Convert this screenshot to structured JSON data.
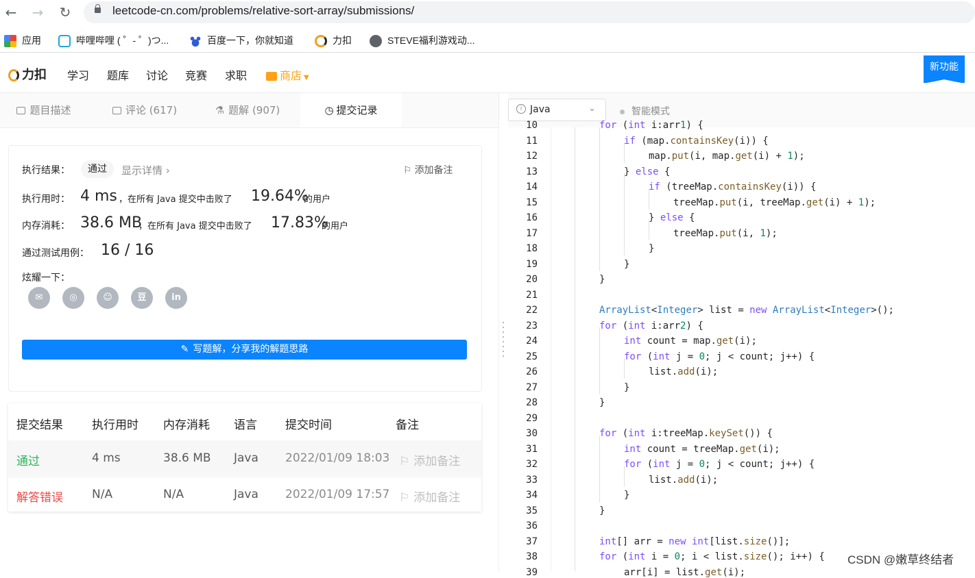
{
  "browser": {
    "url": "leetcode-cn.com/problems/relative-sort-array/submissions/",
    "bookmarks": [
      "应用",
      "哔哩哔哩 ( ゜- ゜)つ...",
      "百度一下，你就知道",
      "力扣",
      "STEVE福利游戏动..."
    ]
  },
  "site": {
    "logo": "力扣",
    "nav": [
      "学习",
      "题库",
      "讨论",
      "竞赛",
      "求职"
    ],
    "shop": "商店",
    "new_feature": "新功能"
  },
  "tabs": [
    {
      "label": "题目描述"
    },
    {
      "label": "评论 (617)"
    },
    {
      "label": "题解 (907)"
    },
    {
      "label": "提交记录"
    }
  ],
  "result": {
    "status_label": "执行结果：",
    "status": "通过",
    "details_link": "显示详情 ›",
    "add_note": "添加备注",
    "runtime_label": "执行用时：",
    "runtime": "4 ms",
    "beat_prefix": "，在所有 Java 提交中击败了",
    "runtime_pct": "19.64%",
    "users": "的用户",
    "memory_label": "内存消耗：",
    "memory": "38.6 MB",
    "memory_pct": "17.83%",
    "tests_label": "通过测试用例：",
    "tests": "16 / 16",
    "share_label": "炫耀一下：",
    "share_icons": [
      "wechat-icon",
      "weibo-icon",
      "qq-icon",
      "douban-icon",
      "linkedin-icon"
    ],
    "share_glyphs": [
      "✉",
      "◎",
      "☺",
      "豆",
      "in"
    ],
    "write_button": "写题解，分享我的解题思路"
  },
  "submissions": {
    "headers": [
      "提交结果",
      "执行用时",
      "内存消耗",
      "语言",
      "提交时间",
      "备注"
    ],
    "rows": [
      {
        "result": "通过",
        "runtime": "4 ms",
        "memory": "38.6 MB",
        "lang": "Java",
        "time": "2022/01/09 18:03",
        "note": "添加备注"
      },
      {
        "result": "解答错误",
        "runtime": "N/A",
        "memory": "N/A",
        "lang": "Java",
        "time": "2022/01/09 17:57",
        "note": "添加备注"
      }
    ]
  },
  "editor": {
    "language": "Java",
    "mode": "智能模式",
    "lines": [
      {
        "n": "10",
        "code": "for (int i:arr1) {"
      },
      {
        "n": "11",
        "code": "if (map.containsKey(i)) {"
      },
      {
        "n": "12",
        "code": "map.put(i, map.get(i) + 1);"
      },
      {
        "n": "13",
        "code": "} else {"
      },
      {
        "n": "14",
        "code": "if (treeMap.containsKey(i)) {"
      },
      {
        "n": "15",
        "code": "treeMap.put(i, treeMap.get(i) + 1);"
      },
      {
        "n": "16",
        "code": "} else {"
      },
      {
        "n": "17",
        "code": "treeMap.put(i, 1);"
      },
      {
        "n": "18",
        "code": "}"
      },
      {
        "n": "19",
        "code": "}"
      },
      {
        "n": "20",
        "code": "}"
      },
      {
        "n": "21",
        "code": ""
      },
      {
        "n": "22",
        "code": "ArrayList<Integer> list = new ArrayList<Integer>();"
      },
      {
        "n": "23",
        "code": "for (int i:arr2) {"
      },
      {
        "n": "24",
        "code": "int count = map.get(i);"
      },
      {
        "n": "25",
        "code": "for (int j = 0; j < count; j++) {"
      },
      {
        "n": "26",
        "code": "list.add(i);"
      },
      {
        "n": "27",
        "code": "}"
      },
      {
        "n": "28",
        "code": "}"
      },
      {
        "n": "29",
        "code": ""
      },
      {
        "n": "30",
        "code": "for (int i:treeMap.keySet()) {"
      },
      {
        "n": "31",
        "code": "int count = treeMap.get(i);"
      },
      {
        "n": "32",
        "code": "for (int j = 0; j < count; j++) {"
      },
      {
        "n": "33",
        "code": "list.add(i);"
      },
      {
        "n": "34",
        "code": "}"
      },
      {
        "n": "35",
        "code": "}"
      },
      {
        "n": "36",
        "code": ""
      },
      {
        "n": "37",
        "code": "int[] arr = new int[list.size()];"
      },
      {
        "n": "38",
        "code": "for (int i = 0; i < list.size(); i++) {"
      },
      {
        "n": "39",
        "code": "arr[i] = list.get(i);"
      }
    ]
  },
  "watermark": "CSDN @嫩草终结者",
  "colors": {
    "accent": "#0a84ff",
    "pass": "#2db55d",
    "error": "#ef4743",
    "shop": "#ffa116"
  }
}
